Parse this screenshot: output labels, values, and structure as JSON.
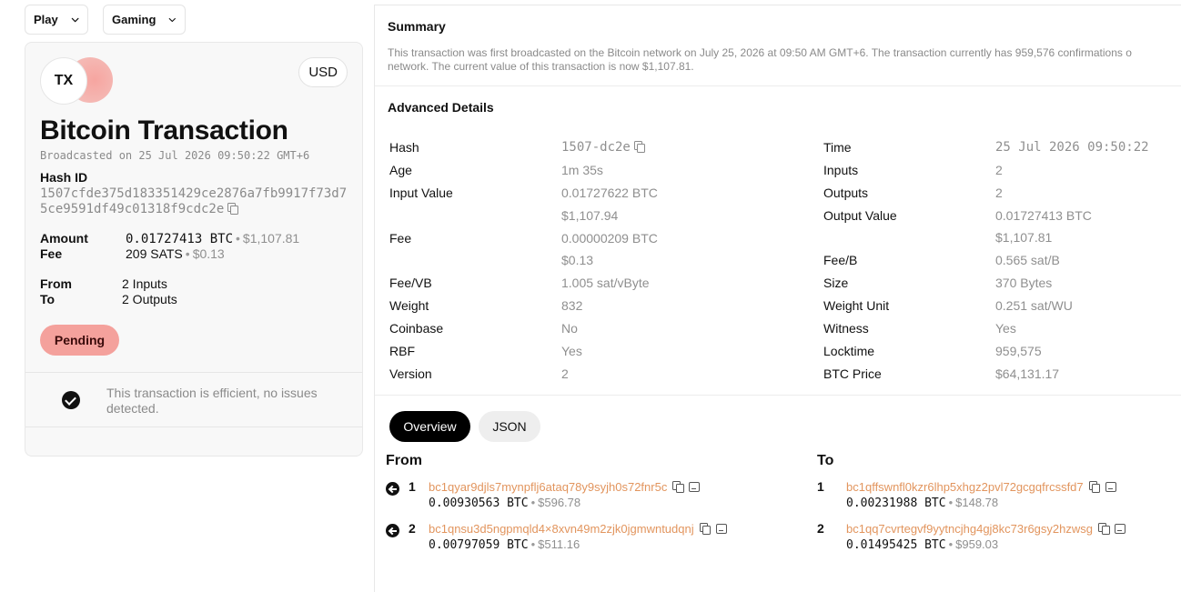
{
  "topbar": {
    "play_label": "Play",
    "gaming_label": "Gaming"
  },
  "card": {
    "logo_text": "TX",
    "currency": "USD",
    "title": "Bitcoin Transaction",
    "broadcasted": "Broadcasted on 25 Jul 2026 09:50:22 GMT+6",
    "hash_label": "Hash ID",
    "hash_value": "1507cfde375d183351429ce2876a7fb9917f73d75ce9591df49c01318f9cdc2e",
    "amount_label": "Amount",
    "amount_btc": "0.01727413 BTC",
    "amount_usd": "$1,107.81",
    "fee_label": "Fee",
    "fee_sats": "209 SATS",
    "fee_usd": "$0.13",
    "from_label": "From",
    "from_value": "2 Inputs",
    "to_label": "To",
    "to_value": "2 Outputs",
    "status": "Pending",
    "efficiency": "This transaction is efficient, no issues detected."
  },
  "summary": {
    "title": "Summary",
    "line1": "This transaction was first broadcasted on the Bitcoin network on July 25, 2026 at 09:50 AM GMT+6. The transaction currently has 959,576 confirmations o",
    "line2": "network. The current value of this transaction is now $1,107.81."
  },
  "advanced": {
    "title": "Advanced Details",
    "hash_k": "Hash",
    "hash_v": "1507-dc2e",
    "age_k": "Age",
    "age_v": "1m 35s",
    "input_value_k": "Input Value",
    "input_value_btc": "0.01727622 BTC",
    "input_value_usd": "$1,107.94",
    "fee_k": "Fee",
    "fee_btc": "0.00000209 BTC",
    "fee_usd": "$0.13",
    "feevb_k": "Fee/VB",
    "feevb_v": "1.005 sat/vByte",
    "weight_k": "Weight",
    "weight_v": "832",
    "coinbase_k": "Coinbase",
    "coinbase_v": "No",
    "rbf_k": "RBF",
    "rbf_v": "Yes",
    "version_k": "Version",
    "version_v": "2",
    "time_k": "Time",
    "time_v": "25 Jul 2026 09:50:22",
    "inputs_k": "Inputs",
    "inputs_v": "2",
    "outputs_k": "Outputs",
    "outputs_v": "2",
    "output_value_k": "Output Value",
    "output_value_btc": "0.01727413 BTC",
    "output_value_usd": "$1,107.81",
    "feeb_k": "Fee/B",
    "feeb_v": "0.565 sat/B",
    "size_k": "Size",
    "size_v": "370 Bytes",
    "weight_unit_k": "Weight Unit",
    "weight_unit_v": "0.251 sat/WU",
    "witness_k": "Witness",
    "witness_v": "Yes",
    "locktime_k": "Locktime",
    "locktime_v": "959,575",
    "btc_price_k": "BTC Price",
    "btc_price_v": "$64,131.17"
  },
  "tabs": {
    "overview": "Overview",
    "json": "JSON"
  },
  "from": {
    "title": "From",
    "items": [
      {
        "num": "1",
        "address": "bc1qyar9djls7mynpflj6ataq78y9syjh0s72fnr5c",
        "btc": "0.00930563 BTC",
        "usd": "$596.78"
      },
      {
        "num": "2",
        "address": "bc1qnsu3d5ngpmqld4×8xvn49m2zjk0jgmwntudqnj",
        "btc": "0.00797059 BTC",
        "usd": "$511.16"
      }
    ]
  },
  "to": {
    "title": "To",
    "items": [
      {
        "num": "1",
        "address": "bc1qffswnfl0kzr6lhp5xhgz2pvl72gcgqfrcssfd7",
        "btc": "0.00231988 BTC",
        "usd": "$148.78"
      },
      {
        "num": "2",
        "address": "bc1qq7cvrtegvf9yytncjhg4gj8kc73r6gsy2hzwsg",
        "btc": "0.01495425 BTC",
        "usd": "$959.03"
      }
    ]
  }
}
